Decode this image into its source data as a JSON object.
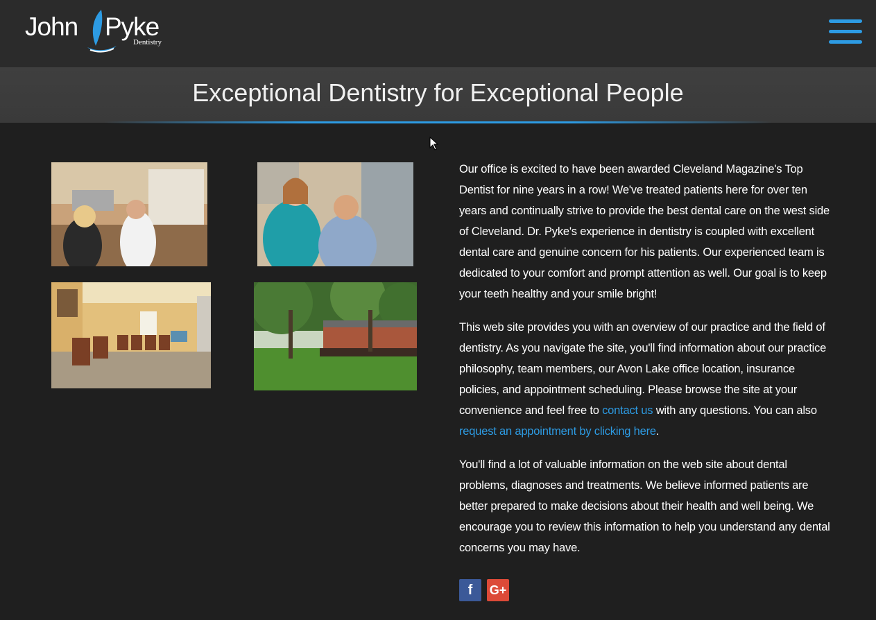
{
  "header": {
    "logo": {
      "first": "John",
      "last": "Pyke",
      "sub": "Dentistry"
    },
    "menu_icon": "hamburger-menu-icon",
    "accent_color": "#2d9be3"
  },
  "hero": {
    "title": "Exceptional Dentistry for Exceptional People"
  },
  "photos": [
    {
      "name": "office-consultation-photo"
    },
    {
      "name": "patient-smiling-photo"
    },
    {
      "name": "waiting-room-photo"
    },
    {
      "name": "office-exterior-photo"
    }
  ],
  "content": {
    "p1": "Our office is excited to have been awarded Cleveland Magazine's Top Dentist for nine years in a row!  We've treated patients here for over ten years and continually strive to provide the best dental care on the west side of Cleveland. Dr. Pyke's experience in dentistry is coupled with excellent dental care and genuine concern for his patients. Our experienced team is dedicated to your comfort and prompt attention as well. Our goal is to keep your teeth healthy and your smile bright!",
    "p2_a": "This web site provides you with an overview of our practice and the field of dentistry. As you navigate the site, you'll find information about our practice philosophy, team members, our Avon Lake office location, insurance policies, and appointment scheduling. Please browse the site at your convenience and feel free to ",
    "p2_link1": "contact us",
    "p2_b": " with any questions. You can also ",
    "p2_link2": "request an appointment by clicking here",
    "p2_c": ".",
    "p3": "You'll find a lot of valuable information on the web site about dental problems, diagnoses and treatments. We believe informed patients are better prepared to make decisions about their health and well being. We encourage you to review this information to help you understand any dental concerns you may have."
  },
  "social": {
    "facebook": {
      "label": "f",
      "icon": "facebook-icon",
      "color": "#3b5998"
    },
    "google": {
      "label": "G+",
      "icon": "google-plus-icon",
      "color": "#dc4a38"
    }
  }
}
